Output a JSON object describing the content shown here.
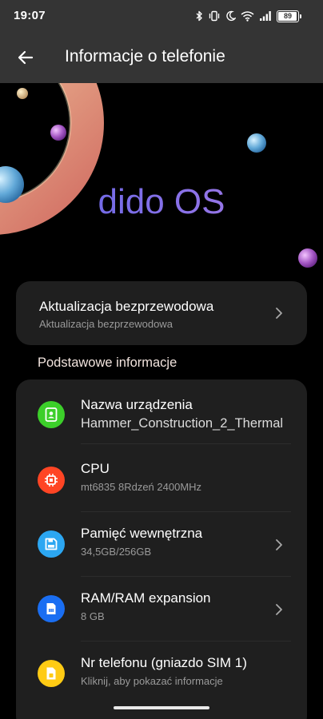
{
  "status_bar": {
    "time": "19:07",
    "battery": "89",
    "battery_fraction": 0.89,
    "icons": [
      "bluetooth-icon",
      "vibrate-icon",
      "do-not-disturb-moon-icon",
      "wifi-icon",
      "signal-icon"
    ]
  },
  "app_bar": {
    "title": "Informacje o telefonie",
    "back_icon": "arrow-back-icon"
  },
  "hero": {
    "os_name": "dido OS"
  },
  "update": {
    "title": "Aktualizacja bezprzewodowa",
    "subtitle": "Aktualizacja bezprzewodowa"
  },
  "basic_info": {
    "section_title": "Podstawowe informacje",
    "items": [
      {
        "title": "Nazwa urządzenia",
        "value": "Hammer_Construction_2_Thermal",
        "icon": "contact-card-icon",
        "color": "#3ccf2a",
        "chevron": false
      },
      {
        "title": "CPU",
        "value": "mt6835 8Rdzeń 2400MHz",
        "icon": "chip-icon",
        "color": "#ff4524",
        "chevron": false
      },
      {
        "title": "Pamięć wewnętrzna",
        "value": "34,5GB/256GB",
        "icon": "storage-icon",
        "color": "#2ca7f2",
        "chevron": true
      },
      {
        "title": "RAM/RAM expansion",
        "value": "8 GB",
        "icon": "memory-icon",
        "color": "#1a6ef2",
        "chevron": true
      },
      {
        "title": "Nr telefonu (gniazdo SIM 1)",
        "value": "Kliknij, aby pokazać informacje",
        "icon": "sim-card-icon",
        "color": "#ffcb14",
        "chevron": false
      }
    ]
  },
  "colors": {
    "background": "#000000",
    "bar": "#343434",
    "card": "#1f1f1f",
    "secondary_text": "#9a9a9a",
    "brand_gradient": [
      "#5d63e0",
      "#b07fe6"
    ]
  }
}
